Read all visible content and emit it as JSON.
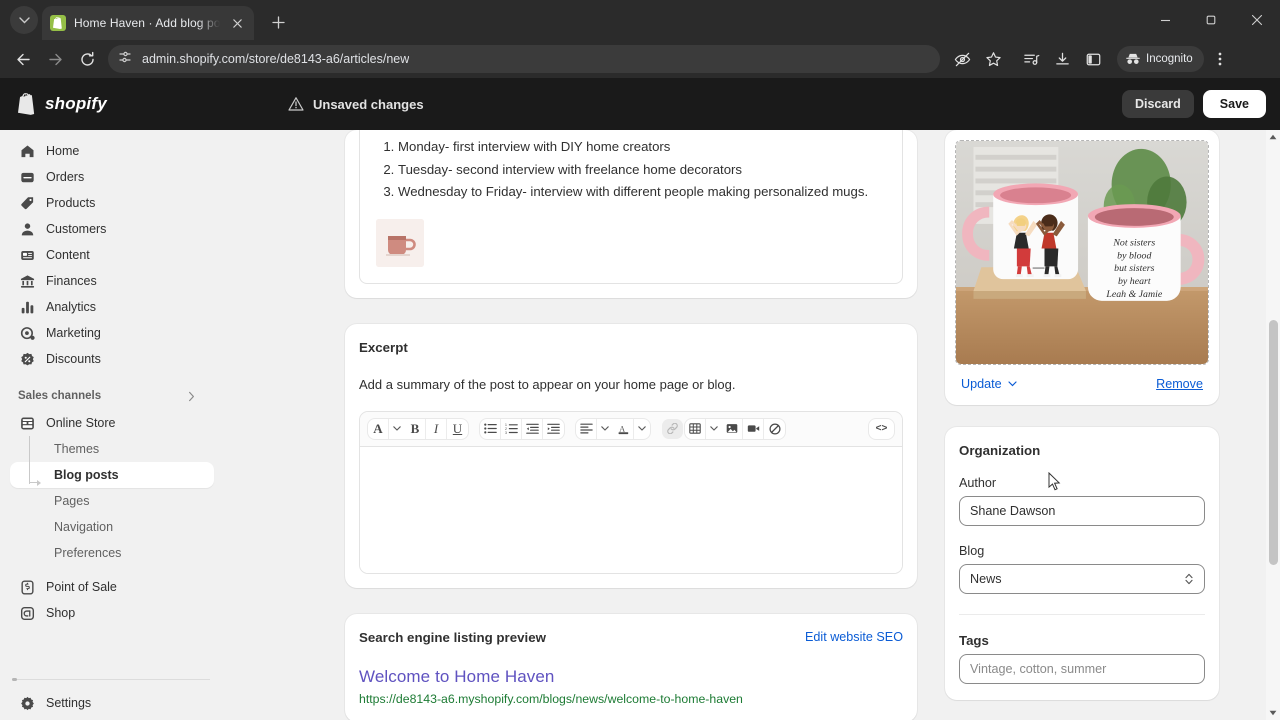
{
  "browser": {
    "tab": {
      "title": "Home Haven · Add blog post ·",
      "favicon": "shopify-icon",
      "close": "close-icon"
    },
    "new_tab_label": "+",
    "window": {
      "minimize": "minimize-icon",
      "maximize": "maximize-icon",
      "close": "close-icon"
    },
    "nav": {
      "back": "back-arrow-icon",
      "forward": "forward-arrow-icon",
      "reload": "reload-icon"
    },
    "omnibox": {
      "site_settings_icon": "tune-icon",
      "url": "admin.shopify.com/store/de8143-a6/articles/new"
    },
    "toolbar_icons": [
      "eye-slash-icon",
      "star-icon",
      "reading-list-icon",
      "download-icon",
      "side-panel-icon"
    ],
    "incognito": {
      "label": "Incognito",
      "icon": "incognito-icon"
    },
    "menu_icon": "kebab-menu-icon"
  },
  "topbar": {
    "logo_text": "shopify",
    "unsaved_text": "Unsaved changes",
    "warning_icon": "warning-triangle-icon",
    "discard_label": "Discard",
    "save_label": "Save"
  },
  "sidebar": {
    "items": [
      {
        "label": "Home",
        "icon": "home-icon"
      },
      {
        "label": "Orders",
        "icon": "orders-inbox-icon"
      },
      {
        "label": "Products",
        "icon": "product-tag-icon"
      },
      {
        "label": "Customers",
        "icon": "person-icon"
      },
      {
        "label": "Content",
        "icon": "content-icon"
      },
      {
        "label": "Finances",
        "icon": "bank-icon"
      },
      {
        "label": "Analytics",
        "icon": "bar-chart-icon"
      },
      {
        "label": "Marketing",
        "icon": "megaphone-target-icon"
      },
      {
        "label": "Discounts",
        "icon": "discount-badge-icon"
      }
    ],
    "section": {
      "label": "Sales channels",
      "chevron": "chevron-right-icon"
    },
    "online_store": {
      "label": "Online Store",
      "icon": "storefront-icon"
    },
    "sub_items": [
      {
        "label": "Themes",
        "active": false
      },
      {
        "label": "Blog posts",
        "active": true
      },
      {
        "label": "Pages",
        "active": false
      },
      {
        "label": "Navigation",
        "active": false
      },
      {
        "label": "Preferences",
        "active": false
      }
    ],
    "channels": [
      {
        "label": "Point of Sale",
        "icon": "pos-icon"
      },
      {
        "label": "Shop",
        "icon": "shop-bag-icon"
      }
    ],
    "settings": {
      "label": "Settings",
      "icon": "gear-icon"
    }
  },
  "content_card": {
    "list_items": [
      "Monday- first interview with DIY home creators",
      "Tuesday- second interview with freelance home decorators",
      "Wednesday to Friday- interview with different people making personalized mugs."
    ],
    "inline_image_alt": "pink-mug-thumbnail"
  },
  "excerpt": {
    "title": "Excerpt",
    "description": "Add a summary of the post to appear on your home page or blog.",
    "toolbar": {
      "group1": [
        {
          "icon": "font-style-icon",
          "glyph": "A"
        },
        {
          "icon": "chevron-down-icon",
          "glyph": "⌄"
        },
        {
          "icon": "bold-icon",
          "glyph": "B"
        },
        {
          "icon": "italic-icon",
          "glyph": "I"
        },
        {
          "icon": "underline-icon",
          "glyph": "U"
        }
      ],
      "group2": [
        {
          "icon": "bulleted-list-icon"
        },
        {
          "icon": "numbered-list-icon"
        },
        {
          "icon": "outdent-icon"
        },
        {
          "icon": "indent-icon"
        }
      ],
      "group3": [
        {
          "icon": "align-left-icon"
        },
        {
          "icon": "chevron-down-icon",
          "glyph": "⌄"
        },
        {
          "icon": "text-color-icon",
          "glyph": "A"
        },
        {
          "icon": "chevron-down-icon",
          "glyph": "⌄"
        }
      ],
      "group4": [
        {
          "icon": "link-icon",
          "disabled": true
        },
        {
          "icon": "table-icon"
        },
        {
          "icon": "chevron-down-icon",
          "glyph": "⌄"
        },
        {
          "icon": "insert-image-icon"
        },
        {
          "icon": "insert-video-icon"
        },
        {
          "icon": "clear-formatting-icon"
        }
      ],
      "group5": [
        {
          "icon": "code-view-icon",
          "glyph": "<>"
        }
      ]
    },
    "body_value": ""
  },
  "seo": {
    "title": "Search engine listing preview",
    "edit_link": "Edit website SEO",
    "preview_title": "Welcome to Home Haven",
    "preview_url": "https://de8143-a6.myshopify.com/blogs/news/welcome-to-home-haven"
  },
  "featured_image": {
    "alt": "two-white-mugs-with-pink-interior-personalized",
    "mug_text_lines": [
      "Not sisters",
      "by blood",
      "but sisters",
      "by heart",
      "Leah & Jamie"
    ],
    "update_label": "Update",
    "update_chevron": "chevron-down-icon",
    "remove_label": "Remove"
  },
  "organization": {
    "title": "Organization",
    "author_label": "Author",
    "author_value": "Shane Dawson",
    "blog_label": "Blog",
    "blog_value": "News",
    "blog_select_icon": "select-updown-icon",
    "tags_label": "Tags",
    "tags_placeholder": "Vintage, cotton, summer"
  },
  "colors": {
    "accent_link": "#0b5cd5",
    "seo_title": "#5f52c0",
    "seo_url": "#1d7b34",
    "chrome_bg": "#2b2b2b",
    "shopify_bar": "#1a1a1a",
    "app_bg": "#f1f1f1",
    "shopify_green": "#95bf47"
  }
}
